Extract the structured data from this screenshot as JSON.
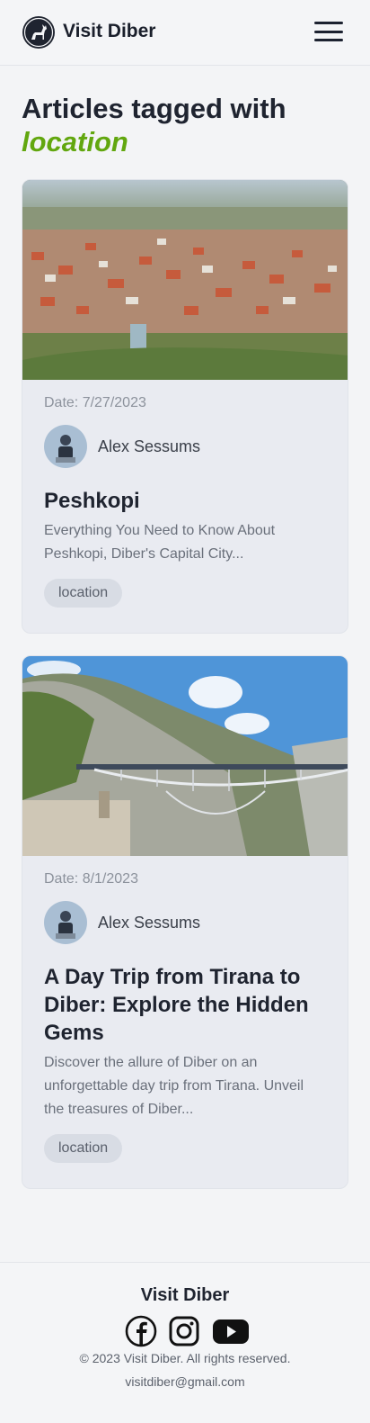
{
  "header": {
    "brand": "Visit Diber",
    "logo_icon": "goat-logo-icon",
    "menu_icon": "hamburger-menu-icon"
  },
  "page": {
    "heading_prefix": "Articles tagged with",
    "tag": "location"
  },
  "articles": [
    {
      "date": "Date: 7/27/2023",
      "author": "Alex Sessums",
      "title": "Peshkopi",
      "excerpt": "Everything You Need to Know About Peshkopi, Diber's Capital City...",
      "tag": "location"
    },
    {
      "date": "Date: 8/1/2023",
      "author": "Alex Sessums",
      "title": "A Day Trip from Tirana to Diber: Explore the Hidden Gems",
      "excerpt": "Discover the allure of Diber on an unforgettable day trip from Tirana. Unveil the treasures of Diber...",
      "tag": "location"
    }
  ],
  "footer": {
    "brand": "Visit Diber",
    "social_icons": [
      "facebook-icon",
      "instagram-icon",
      "youtube-icon"
    ],
    "copyright": "© 2023 Visit Diber. All rights reserved.",
    "email": "visitdiber@gmail.com"
  },
  "colors": {
    "accent": "#62a70f",
    "text": "#1f2430",
    "card": "#e9ebf1"
  }
}
